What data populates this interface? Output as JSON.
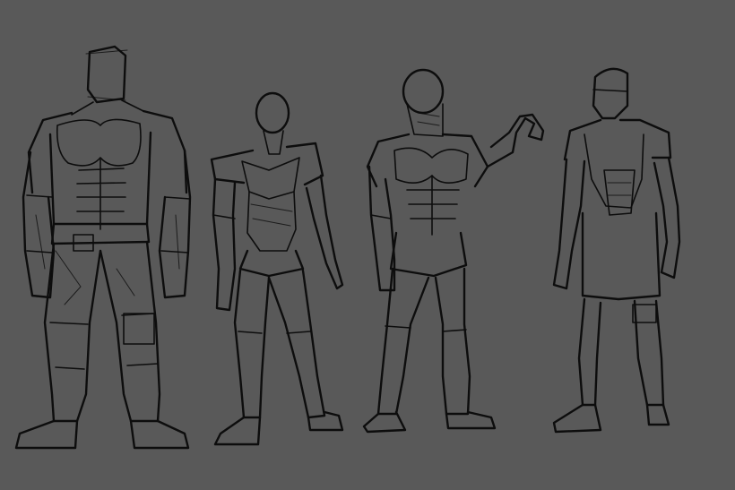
{
  "scene": {
    "kind": "sketch",
    "background_color": "#595959",
    "ink_color": "#0d0d0d",
    "figures": [
      {
        "name": "bulky-humanoid"
      },
      {
        "name": "slim-humanoid"
      },
      {
        "name": "waving-humanoid"
      },
      {
        "name": "android-humanoid"
      }
    ]
  }
}
